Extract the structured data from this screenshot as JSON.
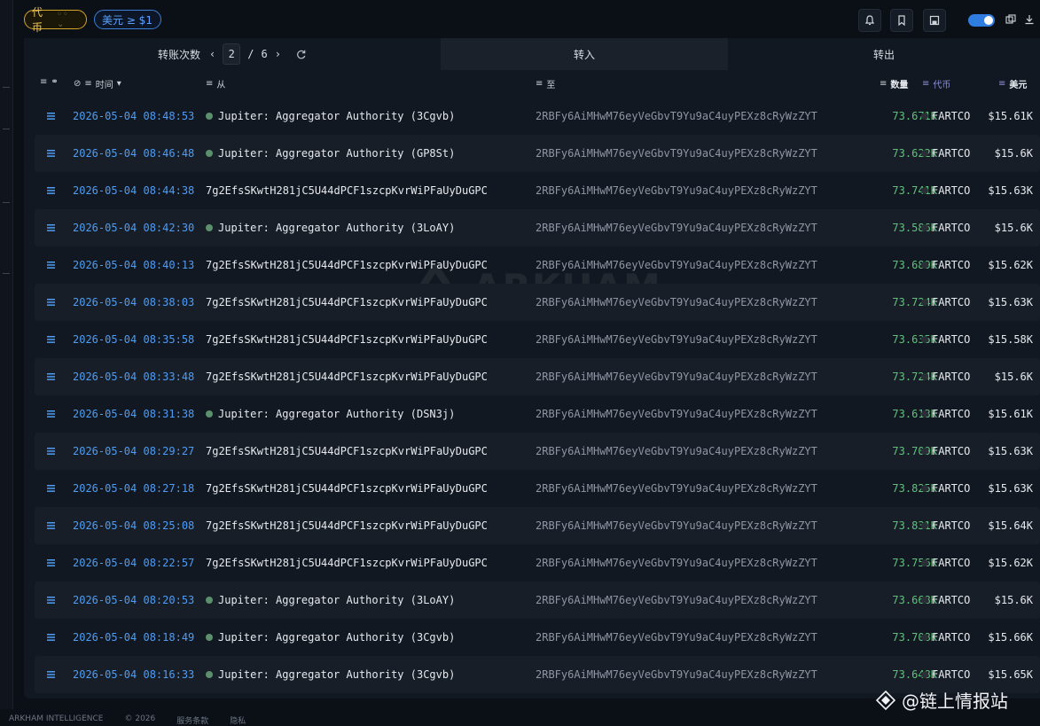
{
  "filters": {
    "token_chip": "代币",
    "usd_chip": "美元 ≥ $1"
  },
  "tabs": {
    "transfers_label": "转账次数",
    "page_current": "2",
    "page_sep": "/",
    "page_total": "6",
    "in_label": "转入",
    "out_label": "转出"
  },
  "columns": {
    "time": "时间",
    "from": "从",
    "to": "至",
    "amount": "数量",
    "token": "代币",
    "usd": "美元"
  },
  "rows": [
    {
      "time": "2026-05-04 08:48:53",
      "from": "Jupiter: Aggregator Authority (3Cgvb)",
      "from_entity": true,
      "to": "2RBFy6AiMHwM76eyVeGbvT9Yu9aC4uyPEXz8cRyWzZYT",
      "amount": "73.671K",
      "token": "FARTCO",
      "usd": "$15.61K"
    },
    {
      "time": "2026-05-04 08:46:48",
      "from": "Jupiter: Aggregator Authority (GP8St)",
      "from_entity": true,
      "to": "2RBFy6AiMHwM76eyVeGbvT9Yu9aC4uyPEXz8cRyWzZYT",
      "amount": "73.622K",
      "token": "FARTCO",
      "usd": "$15.6K"
    },
    {
      "time": "2026-05-04 08:44:38",
      "from": "7g2EfsSKwtH281jC5U44dPCF1szcpKvrWiPFaUyDuGPC",
      "from_entity": false,
      "to": "2RBFy6AiMHwM76eyVeGbvT9Yu9aC4uyPEXz8cRyWzZYT",
      "amount": "73.741K",
      "token": "FARTCO",
      "usd": "$15.63K"
    },
    {
      "time": "2026-05-04 08:42:30",
      "from": "Jupiter: Aggregator Authority (3LoAY)",
      "from_entity": true,
      "to": "2RBFy6AiMHwM76eyVeGbvT9Yu9aC4uyPEXz8cRyWzZYT",
      "amount": "73.586K",
      "token": "FARTCO",
      "usd": "$15.6K"
    },
    {
      "time": "2026-05-04 08:40:13",
      "from": "7g2EfsSKwtH281jC5U44dPCF1szcpKvrWiPFaUyDuGPC",
      "from_entity": false,
      "to": "2RBFy6AiMHwM76eyVeGbvT9Yu9aC4uyPEXz8cRyWzZYT",
      "amount": "73.689K",
      "token": "FARTCO",
      "usd": "$15.62K"
    },
    {
      "time": "2026-05-04 08:38:03",
      "from": "7g2EfsSKwtH281jC5U44dPCF1szcpKvrWiPFaUyDuGPC",
      "from_entity": false,
      "to": "2RBFy6AiMHwM76eyVeGbvT9Yu9aC4uyPEXz8cRyWzZYT",
      "amount": "73.724K",
      "token": "FARTCO",
      "usd": "$15.63K"
    },
    {
      "time": "2026-05-04 08:35:58",
      "from": "7g2EfsSKwtH281jC5U44dPCF1szcpKvrWiPFaUyDuGPC",
      "from_entity": false,
      "to": "2RBFy6AiMHwM76eyVeGbvT9Yu9aC4uyPEXz8cRyWzZYT",
      "amount": "73.635K",
      "token": "FARTCO",
      "usd": "$15.58K"
    },
    {
      "time": "2026-05-04 08:33:48",
      "from": "7g2EfsSKwtH281jC5U44dPCF1szcpKvrWiPFaUyDuGPC",
      "from_entity": false,
      "to": "2RBFy6AiMHwM76eyVeGbvT9Yu9aC4uyPEXz8cRyWzZYT",
      "amount": "73.724K",
      "token": "FARTCO",
      "usd": "$15.6K"
    },
    {
      "time": "2026-05-04 08:31:38",
      "from": "Jupiter: Aggregator Authority (DSN3j)",
      "from_entity": true,
      "to": "2RBFy6AiMHwM76eyVeGbvT9Yu9aC4uyPEXz8cRyWzZYT",
      "amount": "73.613K",
      "token": "FARTCO",
      "usd": "$15.61K"
    },
    {
      "time": "2026-05-04 08:29:27",
      "from": "7g2EfsSKwtH281jC5U44dPCF1szcpKvrWiPFaUyDuGPC",
      "from_entity": false,
      "to": "2RBFy6AiMHwM76eyVeGbvT9Yu9aC4uyPEXz8cRyWzZYT",
      "amount": "73.709K",
      "token": "FARTCO",
      "usd": "$15.63K"
    },
    {
      "time": "2026-05-04 08:27:18",
      "from": "7g2EfsSKwtH281jC5U44dPCF1szcpKvrWiPFaUyDuGPC",
      "from_entity": false,
      "to": "2RBFy6AiMHwM76eyVeGbvT9Yu9aC4uyPEXz8cRyWzZYT",
      "amount": "73.825K",
      "token": "FARTCO",
      "usd": "$15.63K"
    },
    {
      "time": "2026-05-04 08:25:08",
      "from": "7g2EfsSKwtH281jC5U44dPCF1szcpKvrWiPFaUyDuGPC",
      "from_entity": false,
      "to": "2RBFy6AiMHwM76eyVeGbvT9Yu9aC4uyPEXz8cRyWzZYT",
      "amount": "73.831K",
      "token": "FARTCO",
      "usd": "$15.64K"
    },
    {
      "time": "2026-05-04 08:22:57",
      "from": "7g2EfsSKwtH281jC5U44dPCF1szcpKvrWiPFaUyDuGPC",
      "from_entity": false,
      "to": "2RBFy6AiMHwM76eyVeGbvT9Yu9aC4uyPEXz8cRyWzZYT",
      "amount": "73.756K",
      "token": "FARTCO",
      "usd": "$15.62K"
    },
    {
      "time": "2026-05-04 08:20:53",
      "from": "Jupiter: Aggregator Authority (3LoAY)",
      "from_entity": true,
      "to": "2RBFy6AiMHwM76eyVeGbvT9Yu9aC4uyPEXz8cRyWzZYT",
      "amount": "73.668K",
      "token": "FARTCO",
      "usd": "$15.6K"
    },
    {
      "time": "2026-05-04 08:18:49",
      "from": "Jupiter: Aggregator Authority (3Cgvb)",
      "from_entity": true,
      "to": "2RBFy6AiMHwM76eyVeGbvT9Yu9aC4uyPEXz8cRyWzZYT",
      "amount": "73.708K",
      "token": "FARTCO",
      "usd": "$15.66K"
    },
    {
      "time": "2026-05-04 08:16:33",
      "from": "Jupiter: Aggregator Authority (3Cgvb)",
      "from_entity": true,
      "to": "2RBFy6AiMHwM76eyVeGbvT9Yu9aC4uyPEXz8cRyWzZYT",
      "amount": "73.648K",
      "token": "FARTCO",
      "usd": "$15.65K"
    }
  ],
  "watermark": "ARKHAM",
  "footer": {
    "company": "ARKHAM INTELLIGENCE",
    "copyright": "© 2026",
    "terms": "服务条款",
    "privacy": "隐私"
  },
  "brand": {
    "label": "@链上情报站"
  },
  "colors": {
    "accent_blue": "#4d9cf5",
    "amount_green": "#5fc27a",
    "token_chip": "#d4a62a",
    "toggle_on": "#2f7de1"
  }
}
